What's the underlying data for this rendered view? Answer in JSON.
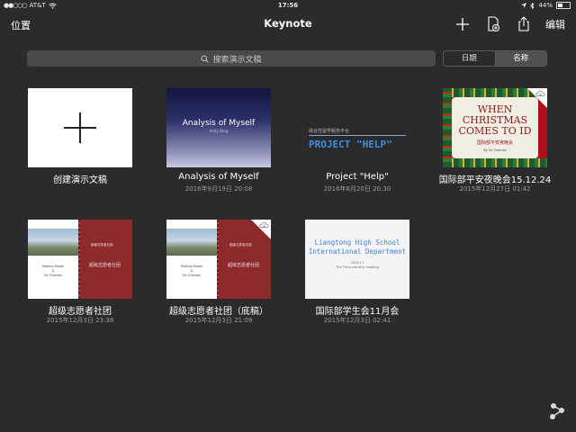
{
  "status_bar": {
    "carrier": "AT&T",
    "time": "17:56",
    "battery_text": "44%",
    "battery_level": 0.44
  },
  "nav": {
    "left_label": "位置",
    "title": "Keynote",
    "edit_label": "编辑",
    "icons": [
      "plus-icon",
      "new-doc-icon",
      "share-icon"
    ]
  },
  "search": {
    "placeholder": "搜索演示文稿"
  },
  "sort": {
    "options": [
      "日期",
      "名称"
    ],
    "selected": "名称"
  },
  "documents": [
    {
      "name": "创建演示文稿",
      "date": ""
    },
    {
      "name": "Analysis of Myself",
      "date": "2016年9月19日 20:08",
      "thumb_title": "Analysis of Myself",
      "thumb_sub": "Andy Ding"
    },
    {
      "name": "Project \"Help\"",
      "date": "2016年8月20日 20:30",
      "thumb_cn": "综合性留学服务平台",
      "thumb_title": "PROJECT \"HELP\""
    },
    {
      "name": "国际部平安夜晚会15.12.24",
      "date": "2015年12月27日 01:42",
      "thumb_title_1": "WHEN",
      "thumb_title_2": "CHRISTMAS",
      "thumb_title_3": "COMES TO ID",
      "thumb_sub": "国际部平安夜晚会",
      "thumb_by": "By Dr. Dramas"
    },
    {
      "name": "超级志愿者社团",
      "date": "2015年12月3日 23:38",
      "thumb_left_1": "Making Model",
      "thumb_left_2": "&",
      "thumb_left_3": "Dr. Dramas",
      "thumb_right_1": "超级志愿者社团",
      "thumb_right_2": "超级志愿者社团"
    },
    {
      "name": "超级志愿者社团（底稿）",
      "date": "2015年12月3日 21:09",
      "thumb_left_1": "Making Model",
      "thumb_left_2": "&",
      "thumb_left_3": "Dr. Dramas",
      "thumb_right_1": "超级志愿者社团",
      "thumb_right_2": "超级志愿者社团"
    },
    {
      "name": "国际部学生会11月会",
      "date": "2015年12月3日 02:41",
      "thumb_title_1": "Liangtong High School",
      "thumb_title_2": "International Department",
      "thumb_sub_1": "2015.11",
      "thumb_sub_2": "The Third monthly meeting"
    }
  ],
  "colors": {
    "background": "#2b2b2d",
    "xmas_red": "#b30f1a",
    "club_red": "#8c2a2c",
    "help_blue": "#3c8fe0"
  }
}
